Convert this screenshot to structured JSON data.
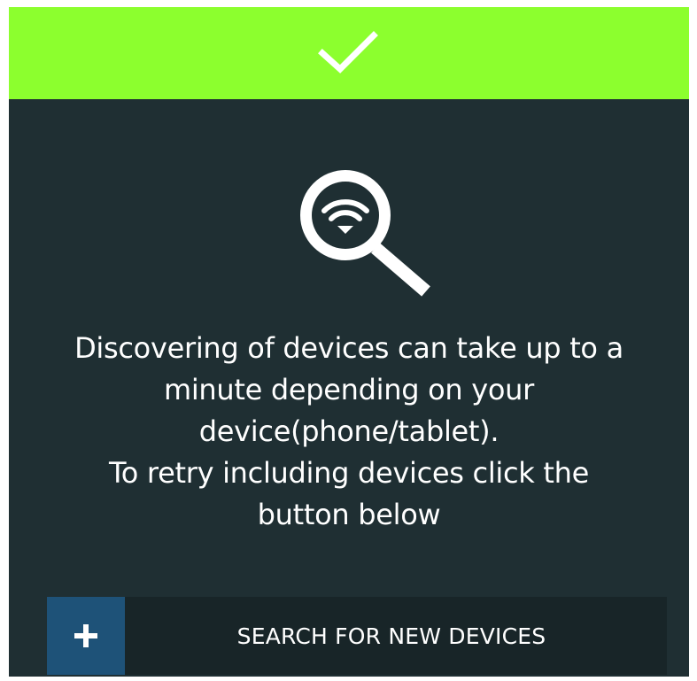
{
  "header": {
    "icon": "checkmark-icon",
    "color": "#8cff2e"
  },
  "illustration": {
    "icon": "magnifier-wifi-icon"
  },
  "message": {
    "lines": [
      "Discovering of devices can take up to a",
      "minute depending on your",
      "device(phone/tablet).",
      "To retry including devices click the",
      "button below"
    ]
  },
  "search_button": {
    "icon": "plus-icon",
    "label": "SEARCH FOR NEW DEVICES",
    "accent": "#1e5278"
  }
}
